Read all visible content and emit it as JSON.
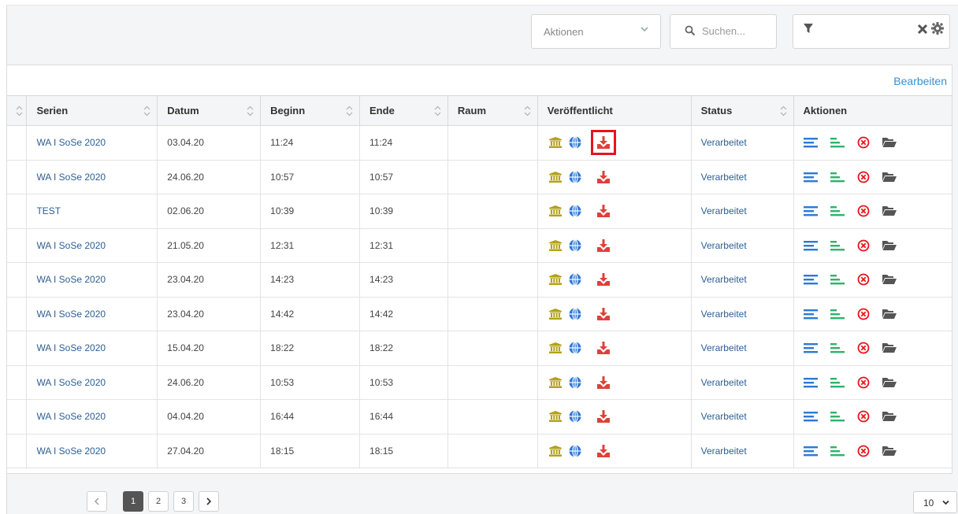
{
  "toolbar": {
    "actions_select": "Aktionen",
    "search_placeholder": "Suchen..."
  },
  "panel": {
    "edit_label": "Bearbeiten"
  },
  "columns": [
    "Serien",
    "Datum",
    "Beginn",
    "Ende",
    "Raum",
    "Veröffentlicht",
    "Status",
    "Aktionen"
  ],
  "rows": [
    {
      "serie": "WA I SoSe 2020",
      "datum": "03.04.20",
      "beginn": "11:24",
      "ende": "11:24",
      "raum": "",
      "status": "Verarbeitet"
    },
    {
      "serie": "WA I SoSe 2020",
      "datum": "24.06.20",
      "beginn": "10:57",
      "ende": "10:57",
      "raum": "",
      "status": "Verarbeitet"
    },
    {
      "serie": "TEST",
      "datum": "02.06.20",
      "beginn": "10:39",
      "ende": "10:39",
      "raum": "",
      "status": "Verarbeitet"
    },
    {
      "serie": "WA I SoSe 2020",
      "datum": "21.05.20",
      "beginn": "12:31",
      "ende": "12:31",
      "raum": "",
      "status": "Verarbeitet"
    },
    {
      "serie": "WA I SoSe 2020",
      "datum": "23.04.20",
      "beginn": "14:23",
      "ende": "14:23",
      "raum": "",
      "status": "Verarbeitet"
    },
    {
      "serie": "WA I SoSe 2020",
      "datum": "23.04.20",
      "beginn": "14:42",
      "ende": "14:42",
      "raum": "",
      "status": "Verarbeitet"
    },
    {
      "serie": "WA I SoSe 2020",
      "datum": "15.04.20",
      "beginn": "18:22",
      "ende": "18:22",
      "raum": "",
      "status": "Verarbeitet"
    },
    {
      "serie": "WA I SoSe 2020",
      "datum": "24.06.20",
      "beginn": "10:53",
      "ende": "10:53",
      "raum": "",
      "status": "Verarbeitet"
    },
    {
      "serie": "WA I SoSe 2020",
      "datum": "04.04.20",
      "beginn": "16:44",
      "ende": "16:44",
      "raum": "",
      "status": "Verarbeitet"
    },
    {
      "serie": "WA I SoSe 2020",
      "datum": "27.04.20",
      "beginn": "18:15",
      "ende": "18:15",
      "raum": "",
      "status": "Verarbeitet"
    }
  ],
  "pagination": {
    "pages": [
      "1",
      "2",
      "3"
    ],
    "current": "1",
    "page_size": "10"
  },
  "colors": {
    "link": "#2c5f93",
    "edit_link": "#3b8ed0",
    "museum_icon": "#b3a11a",
    "globe_icon": "#2d79d6",
    "download_icon": "#e0403a",
    "highlight": "#e8131b",
    "details_icon": "#2d79d6",
    "metadata_icon": "#2fb36b",
    "delete_icon": "#e8131b",
    "folder_icon": "#555555"
  },
  "icons": [
    "chevron-down-icon",
    "search-icon",
    "filter-icon",
    "close-icon",
    "gear-icon",
    "sort-icon",
    "museum-icon",
    "globe-icon",
    "download-icon",
    "details-icon",
    "metadata-icon",
    "delete-icon",
    "folder-icon"
  ]
}
